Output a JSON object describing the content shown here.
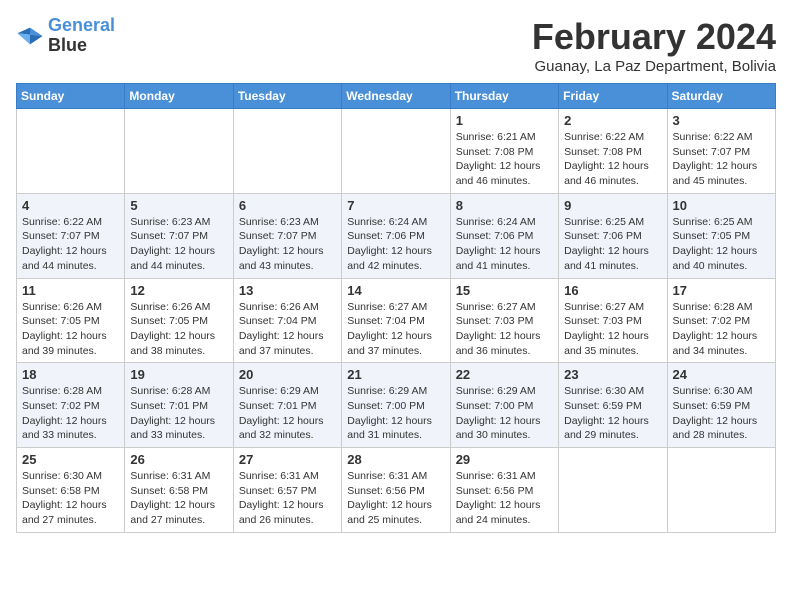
{
  "logo": {
    "line1": "General",
    "line2": "Blue"
  },
  "title": "February 2024",
  "subtitle": "Guanay, La Paz Department, Bolivia",
  "days_of_week": [
    "Sunday",
    "Monday",
    "Tuesday",
    "Wednesday",
    "Thursday",
    "Friday",
    "Saturday"
  ],
  "weeks": [
    [
      {
        "day": "",
        "info": ""
      },
      {
        "day": "",
        "info": ""
      },
      {
        "day": "",
        "info": ""
      },
      {
        "day": "",
        "info": ""
      },
      {
        "day": "1",
        "info": "Sunrise: 6:21 AM\nSunset: 7:08 PM\nDaylight: 12 hours\nand 46 minutes."
      },
      {
        "day": "2",
        "info": "Sunrise: 6:22 AM\nSunset: 7:08 PM\nDaylight: 12 hours\nand 46 minutes."
      },
      {
        "day": "3",
        "info": "Sunrise: 6:22 AM\nSunset: 7:07 PM\nDaylight: 12 hours\nand 45 minutes."
      }
    ],
    [
      {
        "day": "4",
        "info": "Sunrise: 6:22 AM\nSunset: 7:07 PM\nDaylight: 12 hours\nand 44 minutes."
      },
      {
        "day": "5",
        "info": "Sunrise: 6:23 AM\nSunset: 7:07 PM\nDaylight: 12 hours\nand 44 minutes."
      },
      {
        "day": "6",
        "info": "Sunrise: 6:23 AM\nSunset: 7:07 PM\nDaylight: 12 hours\nand 43 minutes."
      },
      {
        "day": "7",
        "info": "Sunrise: 6:24 AM\nSunset: 7:06 PM\nDaylight: 12 hours\nand 42 minutes."
      },
      {
        "day": "8",
        "info": "Sunrise: 6:24 AM\nSunset: 7:06 PM\nDaylight: 12 hours\nand 41 minutes."
      },
      {
        "day": "9",
        "info": "Sunrise: 6:25 AM\nSunset: 7:06 PM\nDaylight: 12 hours\nand 41 minutes."
      },
      {
        "day": "10",
        "info": "Sunrise: 6:25 AM\nSunset: 7:05 PM\nDaylight: 12 hours\nand 40 minutes."
      }
    ],
    [
      {
        "day": "11",
        "info": "Sunrise: 6:26 AM\nSunset: 7:05 PM\nDaylight: 12 hours\nand 39 minutes."
      },
      {
        "day": "12",
        "info": "Sunrise: 6:26 AM\nSunset: 7:05 PM\nDaylight: 12 hours\nand 38 minutes."
      },
      {
        "day": "13",
        "info": "Sunrise: 6:26 AM\nSunset: 7:04 PM\nDaylight: 12 hours\nand 37 minutes."
      },
      {
        "day": "14",
        "info": "Sunrise: 6:27 AM\nSunset: 7:04 PM\nDaylight: 12 hours\nand 37 minutes."
      },
      {
        "day": "15",
        "info": "Sunrise: 6:27 AM\nSunset: 7:03 PM\nDaylight: 12 hours\nand 36 minutes."
      },
      {
        "day": "16",
        "info": "Sunrise: 6:27 AM\nSunset: 7:03 PM\nDaylight: 12 hours\nand 35 minutes."
      },
      {
        "day": "17",
        "info": "Sunrise: 6:28 AM\nSunset: 7:02 PM\nDaylight: 12 hours\nand 34 minutes."
      }
    ],
    [
      {
        "day": "18",
        "info": "Sunrise: 6:28 AM\nSunset: 7:02 PM\nDaylight: 12 hours\nand 33 minutes."
      },
      {
        "day": "19",
        "info": "Sunrise: 6:28 AM\nSunset: 7:01 PM\nDaylight: 12 hours\nand 33 minutes."
      },
      {
        "day": "20",
        "info": "Sunrise: 6:29 AM\nSunset: 7:01 PM\nDaylight: 12 hours\nand 32 minutes."
      },
      {
        "day": "21",
        "info": "Sunrise: 6:29 AM\nSunset: 7:00 PM\nDaylight: 12 hours\nand 31 minutes."
      },
      {
        "day": "22",
        "info": "Sunrise: 6:29 AM\nSunset: 7:00 PM\nDaylight: 12 hours\nand 30 minutes."
      },
      {
        "day": "23",
        "info": "Sunrise: 6:30 AM\nSunset: 6:59 PM\nDaylight: 12 hours\nand 29 minutes."
      },
      {
        "day": "24",
        "info": "Sunrise: 6:30 AM\nSunset: 6:59 PM\nDaylight: 12 hours\nand 28 minutes."
      }
    ],
    [
      {
        "day": "25",
        "info": "Sunrise: 6:30 AM\nSunset: 6:58 PM\nDaylight: 12 hours\nand 27 minutes."
      },
      {
        "day": "26",
        "info": "Sunrise: 6:31 AM\nSunset: 6:58 PM\nDaylight: 12 hours\nand 27 minutes."
      },
      {
        "day": "27",
        "info": "Sunrise: 6:31 AM\nSunset: 6:57 PM\nDaylight: 12 hours\nand 26 minutes."
      },
      {
        "day": "28",
        "info": "Sunrise: 6:31 AM\nSunset: 6:56 PM\nDaylight: 12 hours\nand 25 minutes."
      },
      {
        "day": "29",
        "info": "Sunrise: 6:31 AM\nSunset: 6:56 PM\nDaylight: 12 hours\nand 24 minutes."
      },
      {
        "day": "",
        "info": ""
      },
      {
        "day": "",
        "info": ""
      }
    ]
  ]
}
